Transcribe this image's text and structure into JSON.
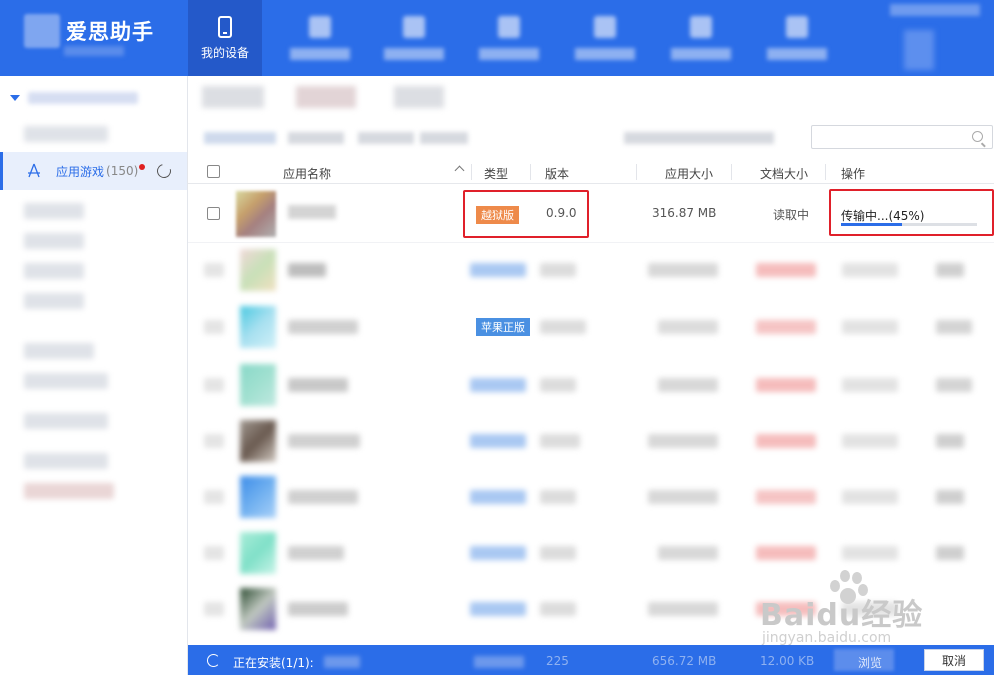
{
  "header": {
    "brand": "爱思助手",
    "active_tab": "我的设备"
  },
  "sidebar": {
    "active_item": {
      "label": "应用游戏",
      "count": "(150)"
    }
  },
  "table": {
    "columns": {
      "name": "应用名称",
      "type": "类型",
      "version": "版本",
      "app_size": "应用大小",
      "doc_size": "文档大小",
      "action": "操作"
    },
    "row": {
      "type_badge": "越狱版",
      "version": "0.9.0",
      "app_size": "316.87 MB",
      "doc_size": "读取中",
      "status": "传输中...(45%)",
      "progress": 0.45
    },
    "row3_type_badge": "苹果正版"
  },
  "statusbar": {
    "text": "正在安装(1/1):",
    "cancel": "取消",
    "partial_count": "225",
    "partial_size": "656.72 MB",
    "partial_doc": "12.00 KB",
    "partial_browse": "浏览"
  },
  "watermark": {
    "text": "Baidu经验",
    "sub": "jingyan.baidu.com"
  },
  "colors": {
    "primary": "#2b6de8",
    "jailbreak_badge": "#ee8a4a",
    "apple_badge": "#4a90e2",
    "highlight": "#e0202a"
  }
}
